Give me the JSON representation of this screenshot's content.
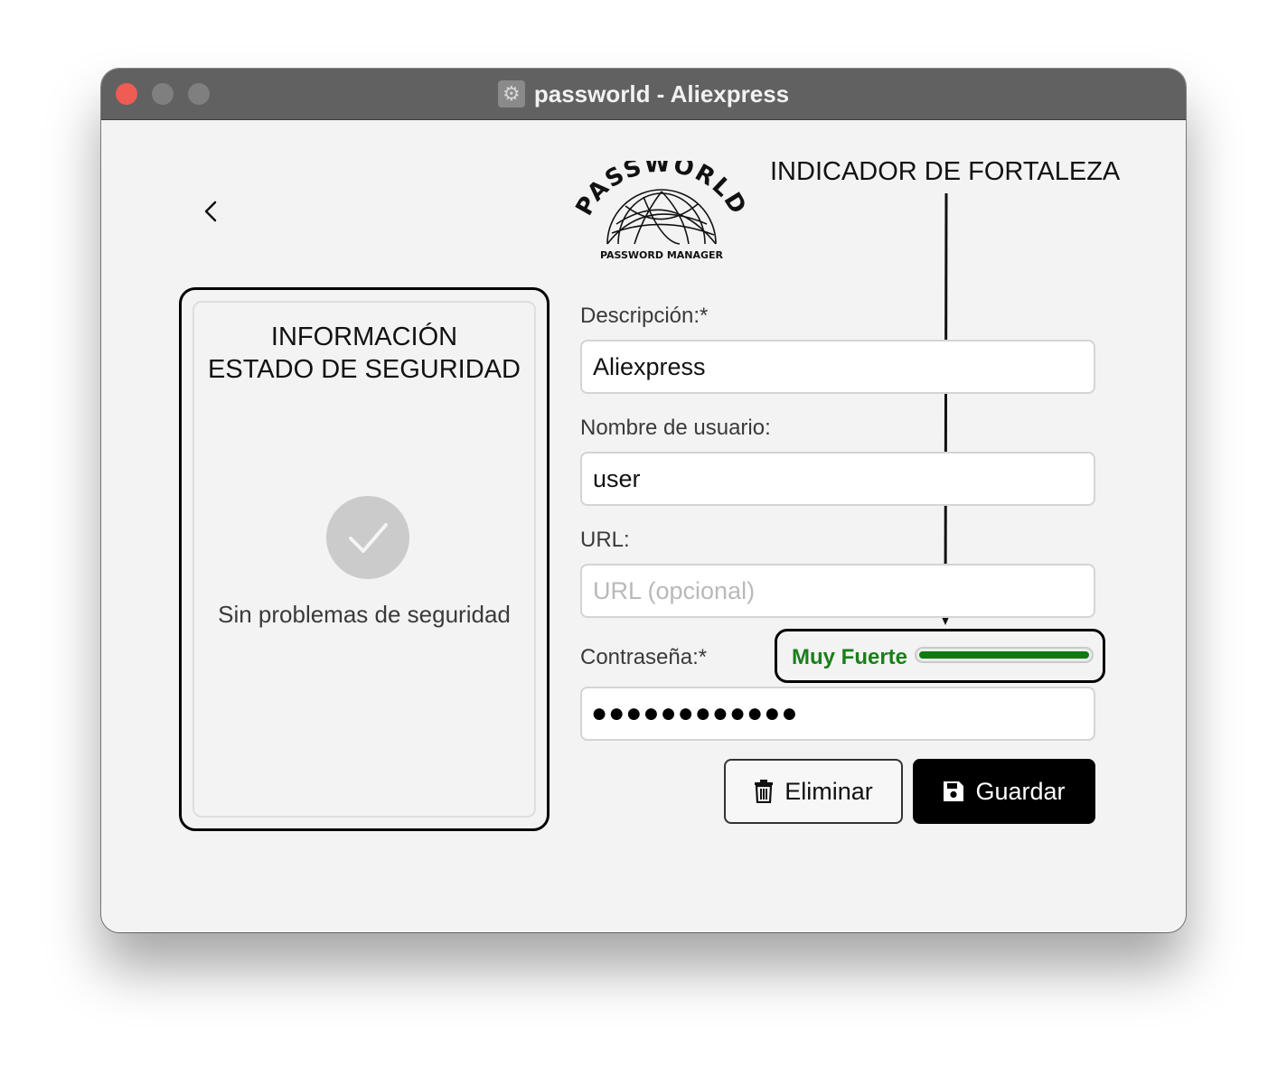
{
  "window": {
    "title": "passworld - Aliexpress",
    "app_icon": "gear-icon"
  },
  "header": {
    "back_icon": "chevron-left-icon",
    "logo_text": "PASSWORLD",
    "logo_subtitle": "PASSWORD MANAGER"
  },
  "annotation": {
    "label": "INDICADOR DE FORTALEZA"
  },
  "security": {
    "title_line1": "INFORMACIÓN",
    "title_line2": "ESTADO DE SEGURIDAD",
    "status_icon": "check-icon",
    "status_text": "Sin problemas de seguridad"
  },
  "form": {
    "description_label": "Descripción:*",
    "description_value": "Aliexpress",
    "username_label": "Nombre de usuario:",
    "username_value": "user",
    "url_label": "URL:",
    "url_placeholder": "URL (opcional)",
    "url_value": "",
    "password_label": "Contraseña:*",
    "password_mask": "●●●●●●●●●●●●"
  },
  "strength": {
    "label": "Muy Fuerte",
    "level": 1.0,
    "color": "#0d7a12"
  },
  "actions": {
    "delete_label": "Eliminar",
    "delete_icon": "trash-icon",
    "save_label": "Guardar",
    "save_icon": "save-icon"
  },
  "colors": {
    "titlebar": "#616161",
    "close": "#ee5c53",
    "strength_text": "#1a7f1a",
    "primary_button": "#000000"
  }
}
